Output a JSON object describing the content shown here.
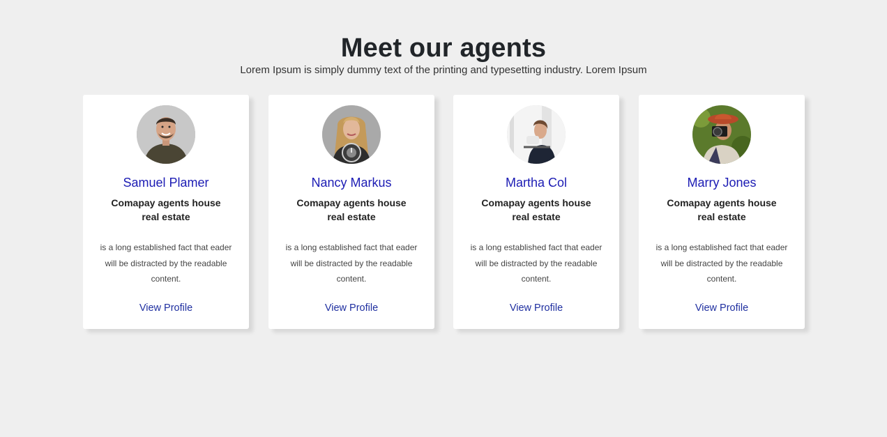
{
  "header": {
    "title": "Meet our agents",
    "subtitle": "Lorem Ipsum is simply dummy text of the printing and typesetting industry. Lorem Ipsum"
  },
  "agents": [
    {
      "name": "Samuel Plamer",
      "company": "Comapay agents house real estate",
      "description": "is a long established fact that eader will be distracted by the readable content.",
      "link": "View Profile",
      "avatar": "man-smiling-photo"
    },
    {
      "name": "Nancy Markus",
      "company": "Comapay agents house real estate",
      "description": "is a long established fact that eader will be distracted by the readable content.",
      "link": "View Profile",
      "avatar": "woman-holding-clock-photo"
    },
    {
      "name": "Martha Col",
      "company": "Comapay agents house real estate",
      "description": "is a long established fact that eader will be distracted by the readable content.",
      "link": "View Profile",
      "avatar": "woman-drinking-coffee-photo"
    },
    {
      "name": "Marry Jones",
      "company": "Comapay agents house real estate",
      "description": "is a long established fact that eader will be distracted by the readable content.",
      "link": "View Profile",
      "avatar": "woman-with-camera-photo"
    }
  ],
  "colors": {
    "background": "#efefef",
    "card": "#ffffff",
    "name": "#1c1cb4",
    "link": "#1f2fa0"
  }
}
